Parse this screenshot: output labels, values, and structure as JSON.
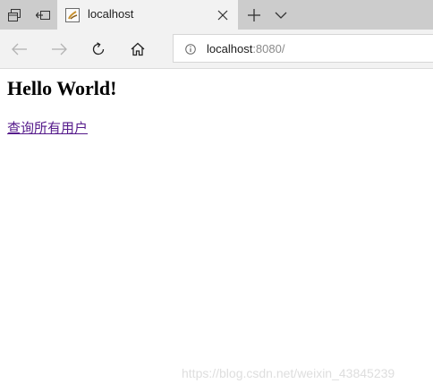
{
  "browser": {
    "tab": {
      "title": "localhost"
    },
    "address": {
      "host": "localhost",
      "path": ":8080/"
    }
  },
  "page": {
    "heading": "Hello World!",
    "link_text": "查询所有用户"
  },
  "watermark": "https://blog.csdn.net/weixin_43845239",
  "icons": {
    "tab_actions": "tab-sets-icon",
    "set_aside": "set-aside-icon",
    "back": "back-arrow-icon",
    "forward": "forward-arrow-icon",
    "refresh": "refresh-icon",
    "home": "home-icon",
    "info": "info-icon",
    "close": "close-icon",
    "new_tab": "plus-icon",
    "tab_menu": "chevron-down-icon"
  },
  "colors": {
    "tabbar": "#cccccc",
    "toolbar": "#f2f2f2",
    "visited_link": "#551a8b"
  }
}
